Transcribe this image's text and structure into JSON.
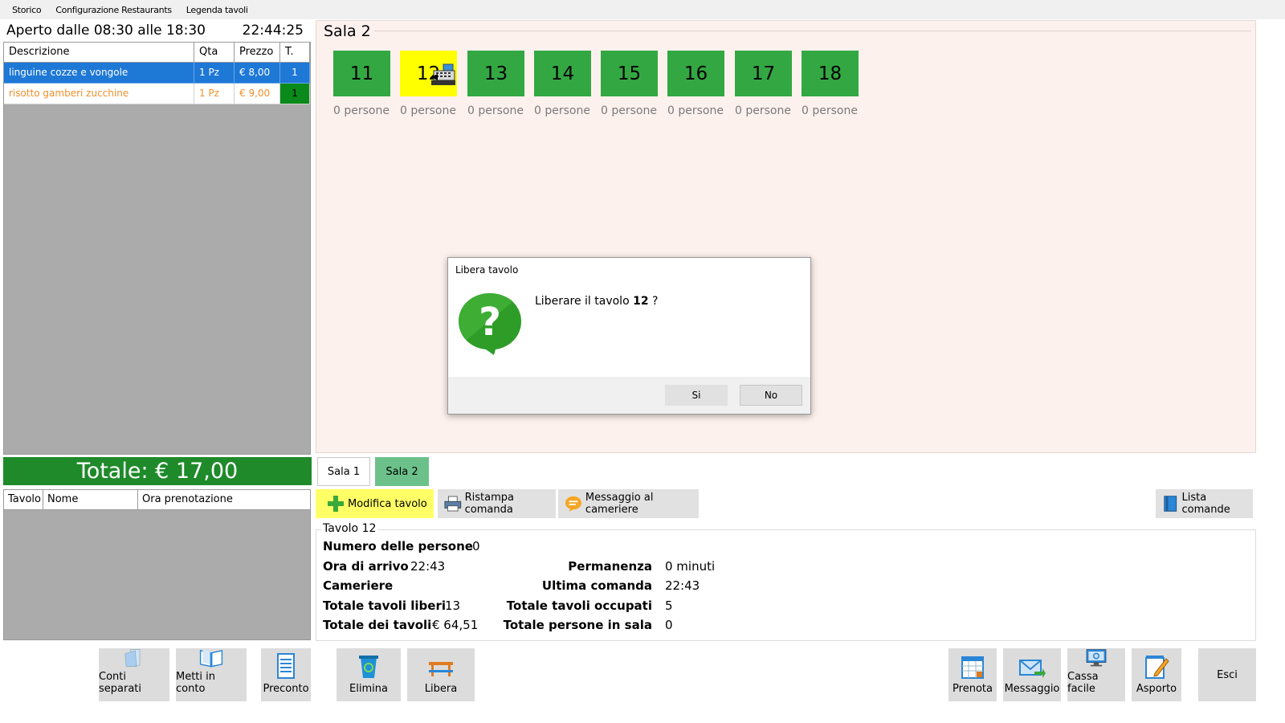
{
  "menu": [
    "Storico",
    "Configurazione Restaurants",
    "Legenda tavoli"
  ],
  "header": {
    "hours": "Aperto dalle 08:30 alle 18:30",
    "clock": "22:44:25"
  },
  "order": {
    "columns": [
      "Descrizione",
      "Qta",
      "Prezzo",
      "T."
    ],
    "rows": [
      {
        "descrizione": "linguine cozze e vongole",
        "qta": "1 Pz",
        "prezzo": "€ 8,00",
        "t": "1"
      },
      {
        "descrizione": "risotto gamberi zucchine",
        "qta": "1 Pz",
        "prezzo": "€ 9,00",
        "t": "1"
      }
    ]
  },
  "total": "Totale: € 17,00",
  "reservations": {
    "columns": [
      "Tavolo",
      "Nome",
      "Ora prenotazione"
    ]
  },
  "sala": {
    "title": "Sala 2",
    "tables": [
      {
        "number": "11",
        "persone": "0 persone",
        "status": "free"
      },
      {
        "number": "12",
        "persone": "0 persone",
        "status": "busy"
      },
      {
        "number": "13",
        "persone": "0 persone",
        "status": "free"
      },
      {
        "number": "14",
        "persone": "0 persone",
        "status": "free"
      },
      {
        "number": "15",
        "persone": "0 persone",
        "status": "free"
      },
      {
        "number": "16",
        "persone": "0 persone",
        "status": "free"
      },
      {
        "number": "17",
        "persone": "0 persone",
        "status": "free"
      },
      {
        "number": "18",
        "persone": "0 persone",
        "status": "free"
      }
    ]
  },
  "dialog": {
    "title": "Libera tavolo",
    "message_prefix": "Liberare il tavolo ",
    "message_table": "12",
    "message_suffix": " ?",
    "yes": "Si",
    "no": "No"
  },
  "tabs": [
    "Sala 1",
    "Sala 2"
  ],
  "toolbar": {
    "modifica": "Modifica tavolo",
    "ristampa": "Ristampa comanda",
    "messaggio": "Messaggio al cameriere",
    "lista": "Lista comande"
  },
  "info": {
    "title": "Tavolo 12",
    "numero_persone_label": "Numero delle persone",
    "numero_persone": "0",
    "ora_arrivo_label": "Ora di arrivo",
    "ora_arrivo": "22:43",
    "cameriere_label": "Cameriere",
    "tavoli_liberi_label": "Totale tavoli liberi",
    "tavoli_liberi": "13",
    "totale_tavoli_label": "Totale dei tavoli",
    "totale_tavoli": "€ 64,51",
    "permanenza_label": "Permanenza",
    "permanenza": "0 minuti",
    "ultima_comanda_label": "Ultima comanda",
    "ultima_comanda": "22:43",
    "tavoli_occupati_label": "Totale tavoli occupati",
    "tavoli_occupati": "5",
    "persone_sala_label": "Totale persone in sala",
    "persone_sala": "0"
  },
  "bottom": {
    "conti": "Conti separati",
    "metti": "Metti in conto",
    "preconto": "Preconto",
    "elimina": "Elimina",
    "libera": "Libera",
    "prenota": "Prenota",
    "messaggio": "Messaggio",
    "cassa": "Cassa facile",
    "asporto": "Asporto",
    "esci": "Esci"
  },
  "colors": {
    "table_free": "#33a842",
    "table_busy": "#ffff00",
    "total_bar": "#1e8a2a",
    "selection": "#1e78d6"
  }
}
